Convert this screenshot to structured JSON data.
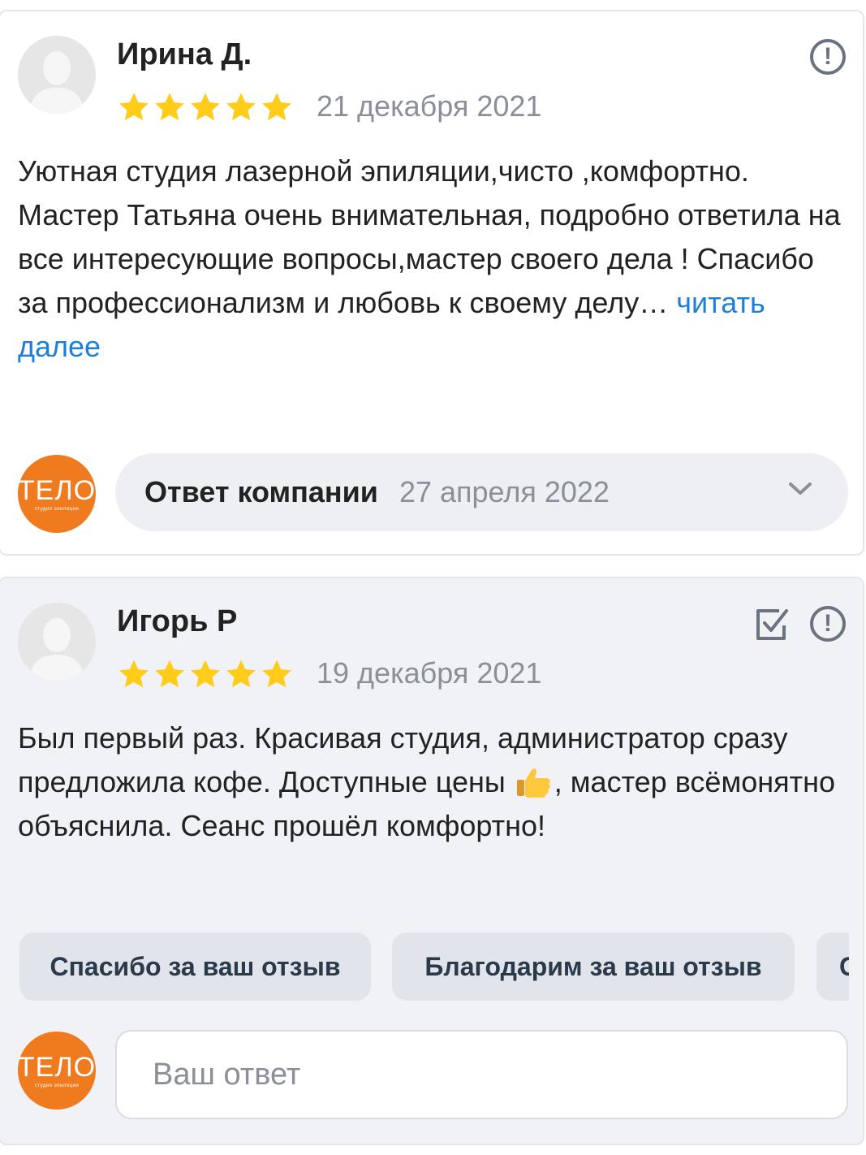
{
  "reviews": [
    {
      "author": "Ирина Д.",
      "rating": 5,
      "date": "21 декабря 2021",
      "text": "Уютная студия лазерной эпиляции,чисто ,комфортно. Мастер Татьяна очень внимательная, подробно ответила на все интересующие вопросы,мастер своего дела ! Спасибо за профессионализм и любовь к своему делу…",
      "read_more": "читать далее",
      "company_answer": {
        "label": "Ответ компании",
        "date": "27 апреля 2022"
      }
    },
    {
      "author": "Игорь Р",
      "rating": 5,
      "date": "19 декабря 2021",
      "text_before_emoji": "Был первый раз. Красивая студия, администратор сразу предложила кофе. Доступные цены ",
      "text_after_emoji": ", мастер всёмонятно объяснила. Сеанс прошёл комфортно!",
      "emoji": "thumbs-up",
      "quick_replies": [
        "Спасибо за ваш отзыв",
        "Благодарим за ваш отзыв",
        "С"
      ],
      "reply_placeholder": "Ваш ответ"
    }
  ],
  "company_logo": {
    "text": "ТЕЛО",
    "subtext": "студия эпиляции",
    "color": "#f07a1e"
  },
  "colors": {
    "star": "#ffcc1a",
    "link": "#1e7fd8",
    "muted": "#8a8f99",
    "card2_bg": "#f1f2f5"
  }
}
